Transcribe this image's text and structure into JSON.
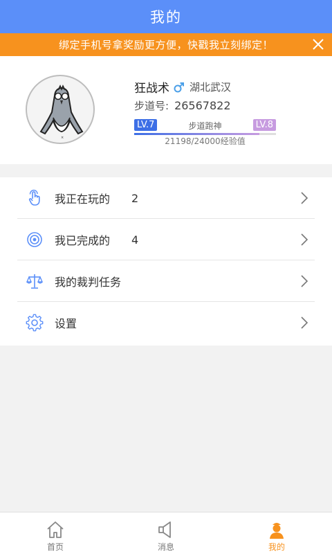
{
  "header": {
    "title": "我的"
  },
  "banner": {
    "text": "绑定手机号拿奖励更方便，快戳我立刻绑定！"
  },
  "profile": {
    "name": "狂战术",
    "gender_symbol": "♂",
    "location": "湖北武汉",
    "id_label": "步道号:",
    "id_value": "26567822",
    "level_current": "LV.7",
    "level_next": "LV.8",
    "rank_title": "步道跑神",
    "exp_text": "21198/24000经验值",
    "exp_progress": 0.883
  },
  "menu": {
    "items": [
      {
        "label": "我正在玩的",
        "count": "2"
      },
      {
        "label": "我已完成的",
        "count": "4"
      },
      {
        "label": "我的裁判任务",
        "count": ""
      },
      {
        "label": "设置",
        "count": ""
      }
    ]
  },
  "tabs": [
    {
      "label": "首页"
    },
    {
      "label": "消息"
    },
    {
      "label": "我的"
    }
  ],
  "colors": {
    "header_blue": "#5b8ff9",
    "banner_orange": "#f7921e",
    "level_current": "#3d6fe6",
    "level_next": "#c79be0",
    "active_tab": "#f7921e"
  }
}
